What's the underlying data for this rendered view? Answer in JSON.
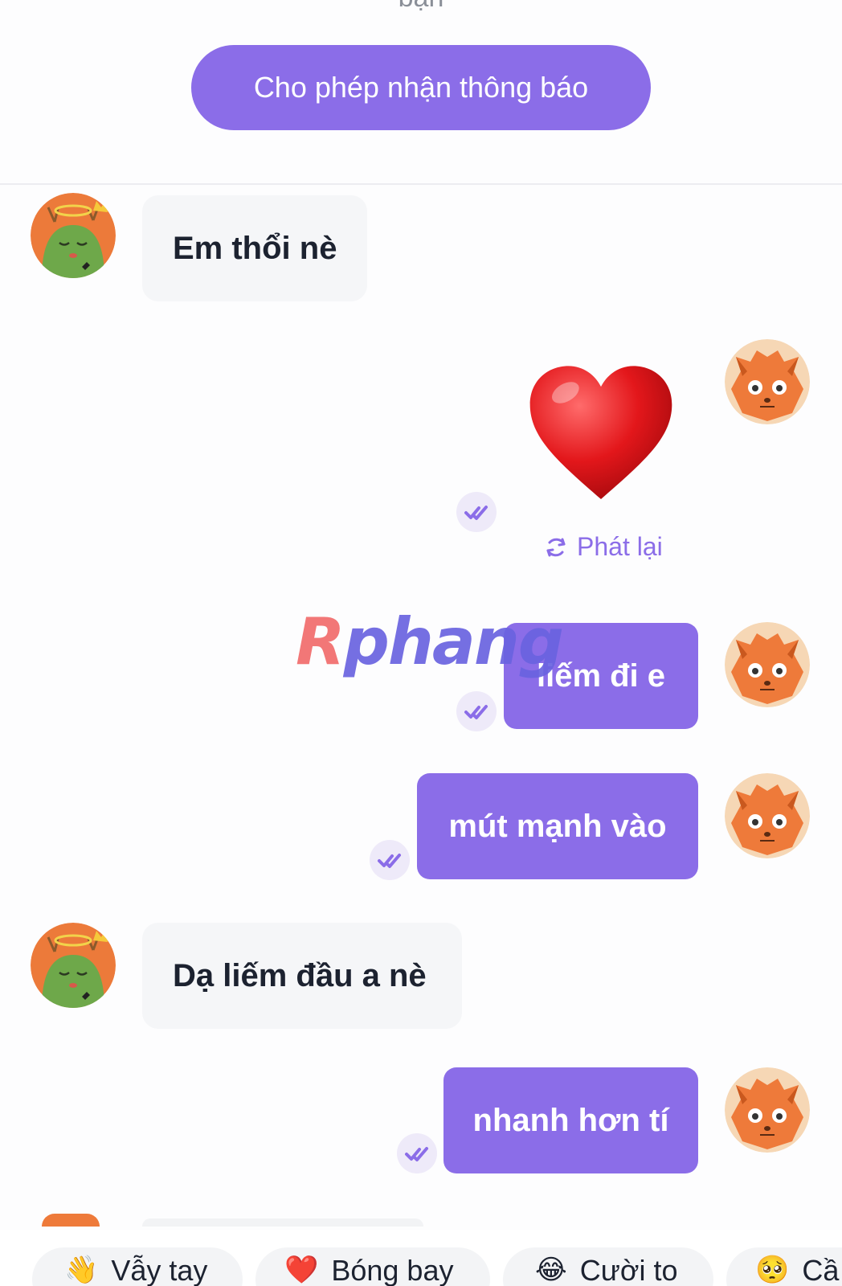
{
  "header": {
    "cut_text": "bạn",
    "notify_button": "Cho phép nhận thông báo"
  },
  "messages": [
    {
      "side": "in",
      "text": "Em thổi nè"
    },
    {
      "side": "out",
      "type": "sticker",
      "sticker": "heart",
      "replay_label": "Phát lại"
    },
    {
      "side": "out",
      "text": "liếm đi e"
    },
    {
      "side": "out",
      "text": "mút mạnh vào"
    },
    {
      "side": "in",
      "text": "Dạ liếm đầu a nè"
    },
    {
      "side": "out",
      "text": "nhanh hơn tí"
    }
  ],
  "watermark": {
    "first": "R",
    "rest": "phang"
  },
  "reactions": [
    {
      "emoji": "👋",
      "label": "Vẫy tay"
    },
    {
      "emoji": "❤️",
      "label": "Bóng bay"
    },
    {
      "emoji": "😂",
      "label": "Cười to"
    },
    {
      "emoji": "🥺",
      "label": "Cầ"
    }
  ],
  "colors": {
    "accent": "#8b6de8",
    "incoming_bubble": "#f5f6f8",
    "outgoing_text": "#ffffff"
  },
  "icons": [
    "double-check-icon",
    "replay-icon",
    "heart-sticker",
    "dragon-avatar",
    "fox-avatar"
  ]
}
